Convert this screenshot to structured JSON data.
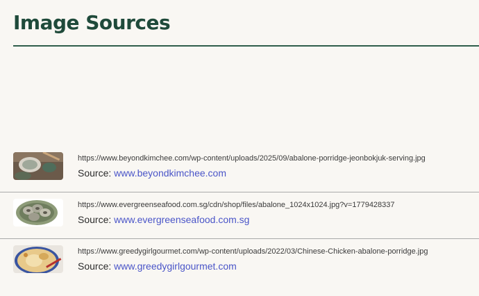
{
  "header": {
    "title": "Image Sources"
  },
  "sources": [
    {
      "url": "https://www.beyondkimchee.com/wp-content/uploads/2025/09/abalone-porridge-jeonbokjuk-serving.jpg",
      "source_label": "Source:",
      "source_link": "www.beyondkimchee.com",
      "thumb_icon": "abalone-porridge-bowl-thumbnail"
    },
    {
      "url": "https://www.evergreenseafood.com.sg/cdn/shop/files/abalone_1024x1024.jpg?v=1779428337",
      "source_label": "Source:",
      "source_link": "www.evergreenseafood.com.sg",
      "thumb_icon": "abalone-plate-thumbnail"
    },
    {
      "url": "https://www.greedygirlgourmet.com/wp-content/uploads/2022/03/Chinese-Chicken-abalone-porridge.jpg",
      "source_label": "Source:",
      "source_link": "www.greedygirlgourmet.com",
      "thumb_icon": "chicken-abalone-porridge-thumbnail"
    }
  ]
}
